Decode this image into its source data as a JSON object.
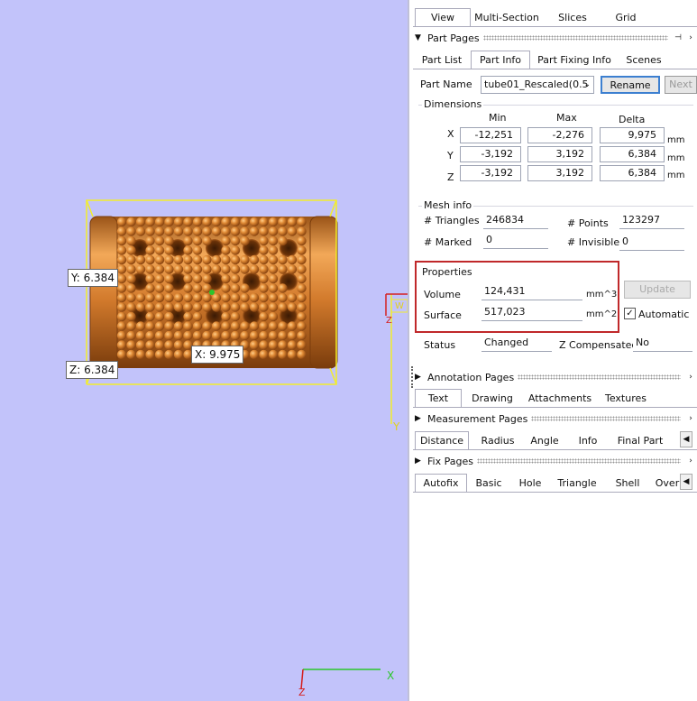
{
  "viewport": {
    "y_label": "Y: 6.384",
    "z_label": "Z: 6.384",
    "x_label": "X: 9.975",
    "axis_y": "Y",
    "axis_z": "Z",
    "axis_w": "W",
    "axis_x_small": "X",
    "axis_z_small": "Z"
  },
  "top_tabs": [
    "View",
    "Multi-Section",
    "Slices",
    "Grid"
  ],
  "part_pages": {
    "title": "Part Pages",
    "tabs": [
      "Part List",
      "Part Info",
      "Part Fixing Info",
      "Scenes"
    ]
  },
  "part_name": {
    "label": "Part Name",
    "value": "tube01_Rescaled(0.5",
    "rename": "Rename",
    "next": "Next"
  },
  "dimensions": {
    "title": "Dimensions",
    "headers": [
      "Min",
      "Max",
      "Delta"
    ],
    "rows": [
      {
        "axis": "X",
        "min": "-12,251",
        "max": "-2,276",
        "delta": "9,975",
        "unit": "mm"
      },
      {
        "axis": "Y",
        "min": "-3,192",
        "max": "3,192",
        "delta": "6,384",
        "unit": "mm"
      },
      {
        "axis": "Z",
        "min": "-3,192",
        "max": "3,192",
        "delta": "6,384",
        "unit": "mm"
      }
    ]
  },
  "mesh_info": {
    "title": "Mesh info",
    "triangles_label": "# Triangles",
    "triangles": "246834",
    "points_label": "# Points",
    "points": "123297",
    "marked_label": "# Marked",
    "marked": "0",
    "invisible_label": "# Invisible",
    "invisible": "0"
  },
  "properties": {
    "title": "Properties",
    "volume_label": "Volume",
    "volume": "124,431",
    "volume_unit": "mm^3",
    "surface_label": "Surface",
    "surface": "517,023",
    "surface_unit": "mm^2",
    "update": "Update",
    "automatic": "Automatic",
    "highlight_color": "#c0282a"
  },
  "status": {
    "label": "Status",
    "value": "Changed",
    "zc_label": "Z Compensated",
    "zc_value": "No"
  },
  "annotation_pages": {
    "title": "Annotation Pages",
    "tabs": [
      "Text",
      "Drawing",
      "Attachments",
      "Textures"
    ]
  },
  "measurement_pages": {
    "title": "Measurement Pages",
    "tabs": [
      "Distance",
      "Radius",
      "Angle",
      "Info",
      "Final Part"
    ]
  },
  "fix_pages": {
    "title": "Fix Pages",
    "tabs": [
      "Autofix",
      "Basic",
      "Hole",
      "Triangle",
      "Shell",
      "Over"
    ]
  },
  "colors": {
    "viewport_bg": "#c2c3fa",
    "model": "#cf7a27",
    "bbox": "#f3ee2a",
    "axis_green": "#2bc62b",
    "axis_red": "#d42020"
  }
}
